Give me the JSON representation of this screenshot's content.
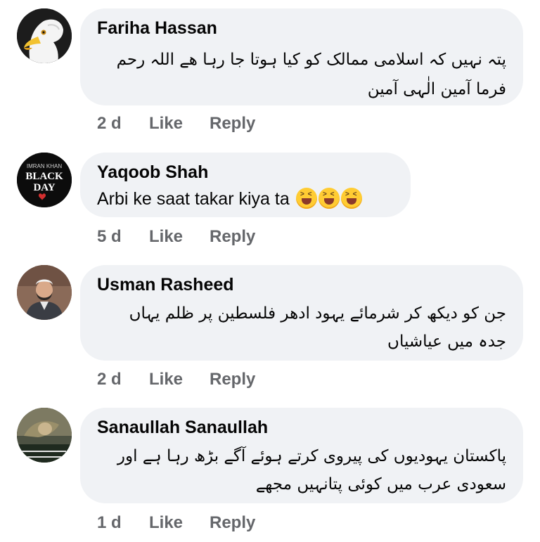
{
  "comments": [
    {
      "author": "Fariha Hassan",
      "text_lines": [
        "پتہ نہیں کہ اسلامی ممالک کو کیا ہوتا جا رہا ھے اللہ رحم",
        "فرما آمین الٰہی آمین"
      ],
      "time": "2 d",
      "like": "Like",
      "reply": "Reply"
    },
    {
      "author": "Yaqoob Shah",
      "text": "Arbi ke saat takar kiya ta",
      "emojis": [
        "squinting-face-with-tongue",
        "squinting-face-with-tongue",
        "squinting-face-with-tongue"
      ],
      "avatar_text": {
        "top": "IMRAN KHAN",
        "middle1": "BLACK",
        "middle2": "DAY"
      },
      "time": "5 d",
      "like": "Like",
      "reply": "Reply"
    },
    {
      "author": "Usman Rasheed",
      "text_lines": [
        "جن کو دیکھ کر شرمائے یہود ادھر فلسطین پر ظلم یہاں",
        "جدہ میں عیاشیاں"
      ],
      "time": "2 d",
      "like": "Like",
      "reply": "Reply"
    },
    {
      "author": "Sanaullah Sanaullah",
      "text_lines": [
        "پاکستان یہودیوں کی پیروی کرتے ہوئے آگے بڑھ رہا ہے اور",
        "سعودی عرب میں کوئی پتانہیں مجھے"
      ],
      "time": "1 d",
      "like": "Like",
      "reply": "Reply"
    }
  ]
}
